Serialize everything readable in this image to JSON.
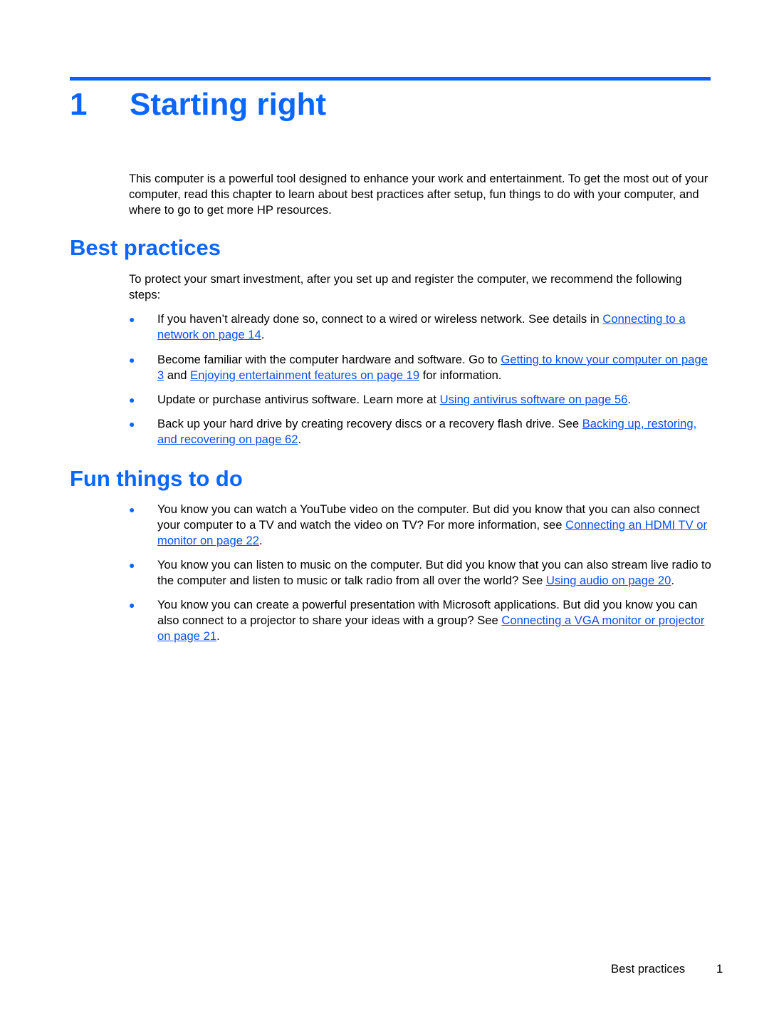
{
  "chapter": {
    "number": "1",
    "title": "Starting right"
  },
  "intro": "This computer is a powerful tool designed to enhance your work and entertainment. To get the most out of your computer, read this chapter to learn about best practices after setup, fun things to do with your computer, and where to go to get more HP resources.",
  "best_practices": {
    "heading": "Best practices",
    "intro": "To protect your smart investment, after you set up and register the computer, we recommend the following steps:",
    "items": [
      {
        "before": "If you haven’t already done so, connect to a wired or wireless network. See details in ",
        "link": "Connecting to a network on page 14",
        "after": "."
      },
      {
        "before": "Become familiar with the computer hardware and software. Go to ",
        "link": "Getting to know your computer on page 3",
        "middle": " and ",
        "link2": "Enjoying entertainment features on page 19",
        "after": " for information."
      },
      {
        "before": "Update or purchase antivirus software. Learn more at ",
        "link": "Using antivirus software on page 56",
        "after": "."
      },
      {
        "before": "Back up your hard drive by creating recovery discs or a recovery flash drive. See ",
        "link": "Backing up, restoring, and recovering on page 62",
        "after": "."
      }
    ]
  },
  "fun_things": {
    "heading": "Fun things to do",
    "items": [
      {
        "before": "You know you can watch a YouTube video on the computer. But did you know that you can also connect your computer to a TV and watch the video on TV? For more information, see ",
        "link": "Connecting an HDMI TV or monitor on page 22",
        "after": "."
      },
      {
        "before": "You know you can listen to music on the computer. But did you know that you can also stream live radio to the computer and listen to music or talk radio from all over the world? See ",
        "link": "Using audio on page 20",
        "after": "."
      },
      {
        "before": "You know you can create a powerful presentation with Microsoft applications. But did you know you can also connect to a projector to share your ideas with a group? See ",
        "link": "Connecting a VGA monitor or projector on page 21",
        "after": "."
      }
    ]
  },
  "footer": {
    "section": "Best practices",
    "page": "1"
  },
  "bullet_glyph": "●"
}
